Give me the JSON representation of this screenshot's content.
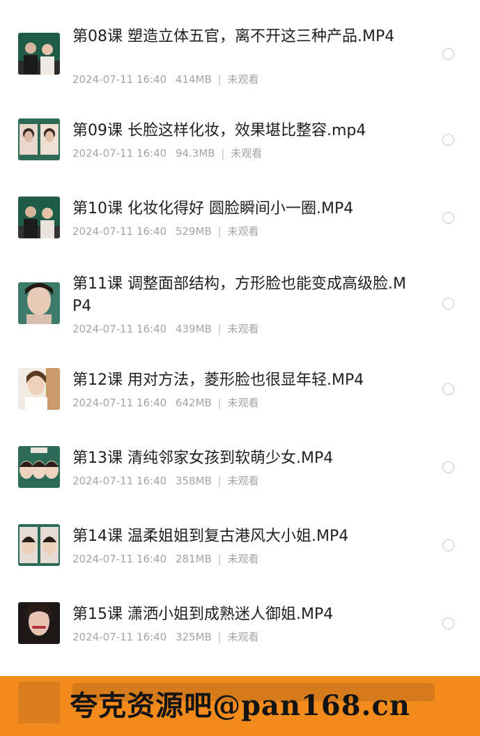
{
  "files": [
    {
      "title": "第08课 塑造立体五官，离不开这三种产品.MP4",
      "date": "2024-07-11 16:40",
      "size": "414MB",
      "status": "未观看"
    },
    {
      "title": "第09课 长脸这样化妆，效果堪比整容.mp4",
      "date": "2024-07-11 16:40",
      "size": "94.3MB",
      "status": "未观看"
    },
    {
      "title": "第10课 化妆化得好 圆脸瞬间小一圈.MP4",
      "date": "2024-07-11 16:40",
      "size": "529MB",
      "status": "未观看"
    },
    {
      "title": "第11课 调整面部结构，方形脸也能变成高级脸.MP4",
      "date": "2024-07-11 16:40",
      "size": "439MB",
      "status": "未观看"
    },
    {
      "title": "第12课 用对方法，菱形脸也很显年轻.MP4",
      "date": "2024-07-11 16:40",
      "size": "642MB",
      "status": "未观看"
    },
    {
      "title": "第13课 清纯邻家女孩到软萌少女.MP4",
      "date": "2024-07-11 16:40",
      "size": "358MB",
      "status": "未观看"
    },
    {
      "title": "第14课 温柔姐姐到复古港风大小姐.MP4",
      "date": "2024-07-11 16:40",
      "size": "281MB",
      "status": "未观看"
    },
    {
      "title": "第15课 潇洒小姐到成熟迷人御姐.MP4",
      "date": "2024-07-11 16:40",
      "size": "325MB",
      "status": "未观看"
    }
  ],
  "watermark": "夸克资源吧@pan168.cn",
  "colors": {
    "banner": "#f28a1c",
    "title": "#1f1f1f",
    "meta": "#a4a4a4"
  }
}
